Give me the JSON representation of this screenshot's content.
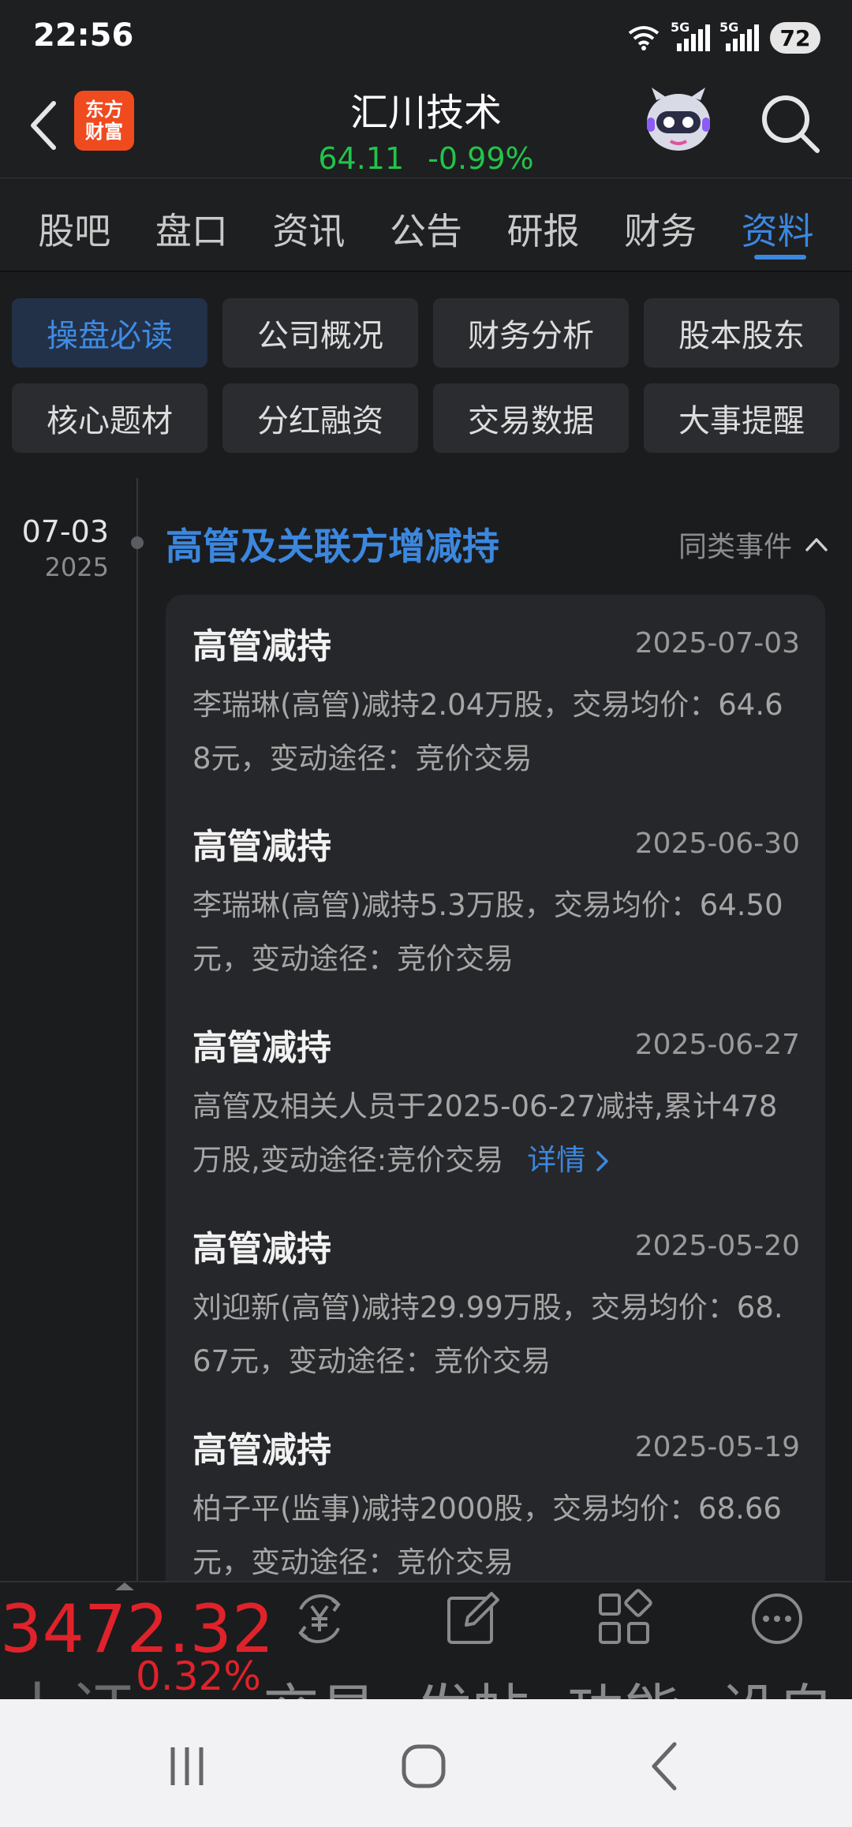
{
  "status_bar": {
    "time": "22:56",
    "network1": "5G",
    "network2": "5G",
    "battery": "72"
  },
  "header": {
    "logo_line1": "东方",
    "logo_line2": "财富",
    "stock_name": "汇川技术",
    "price": "64.11",
    "change_pct": "-0.99%"
  },
  "tabs": [
    "股吧",
    "盘口",
    "资讯",
    "公告",
    "研报",
    "财务",
    "资料"
  ],
  "active_tab": "资料",
  "sub_buttons": [
    "操盘必读",
    "公司概况",
    "财务分析",
    "股本股东",
    "核心题材",
    "分红融资",
    "交易数据",
    "大事提醒"
  ],
  "timeline": {
    "date": "07-03",
    "year": "2025",
    "event_title": "高管及关联方增减持",
    "similar_events": "同类事件",
    "items": [
      {
        "type": "高管减持",
        "date": "2025-07-03",
        "desc_line1": "李瑞琳(高管)减持2.04万股，交易均价：64.6",
        "desc_line2": "8元，变动途径：竞价交易"
      },
      {
        "type": "高管减持",
        "date": "2025-06-30",
        "desc_line1": "李瑞琳(高管)减持5.3万股，交易均价：64.50",
        "desc_line2": "元，变动途径：竞价交易"
      },
      {
        "type": "高管减持",
        "date": "2025-06-27",
        "desc_line1": "高管及相关人员于2025-06-27减持,累计478",
        "desc_line2": "万股,变动途径:竞价交易",
        "more": "详情"
      },
      {
        "type": "高管减持",
        "date": "2025-05-20",
        "desc_line1": "刘迎新(高管)减持29.99万股，交易均价：68.",
        "desc_line2": "67元，变动途径：竞价交易"
      },
      {
        "type": "高管减持",
        "date": "2025-05-19",
        "desc_line1": "柏子平(监事)减持2000股，交易均价：68.66",
        "desc_line2": "元，变动途径：竞价交易"
      }
    ]
  },
  "bottom_bar": {
    "index_price": "3472.32",
    "index_name": "上证",
    "index_change": "0.32%",
    "nav": [
      {
        "label": "交易",
        "icon": "yen-cycle-icon"
      },
      {
        "label": "发帖",
        "icon": "edit-icon"
      },
      {
        "label": "功能",
        "icon": "apps-icon"
      },
      {
        "label": "设自",
        "icon": "more-icon"
      }
    ]
  },
  "colors": {
    "accent": "#3b87e0",
    "down": "#22c44a",
    "up": "#e0222a",
    "bg": "#1b1c1e"
  }
}
